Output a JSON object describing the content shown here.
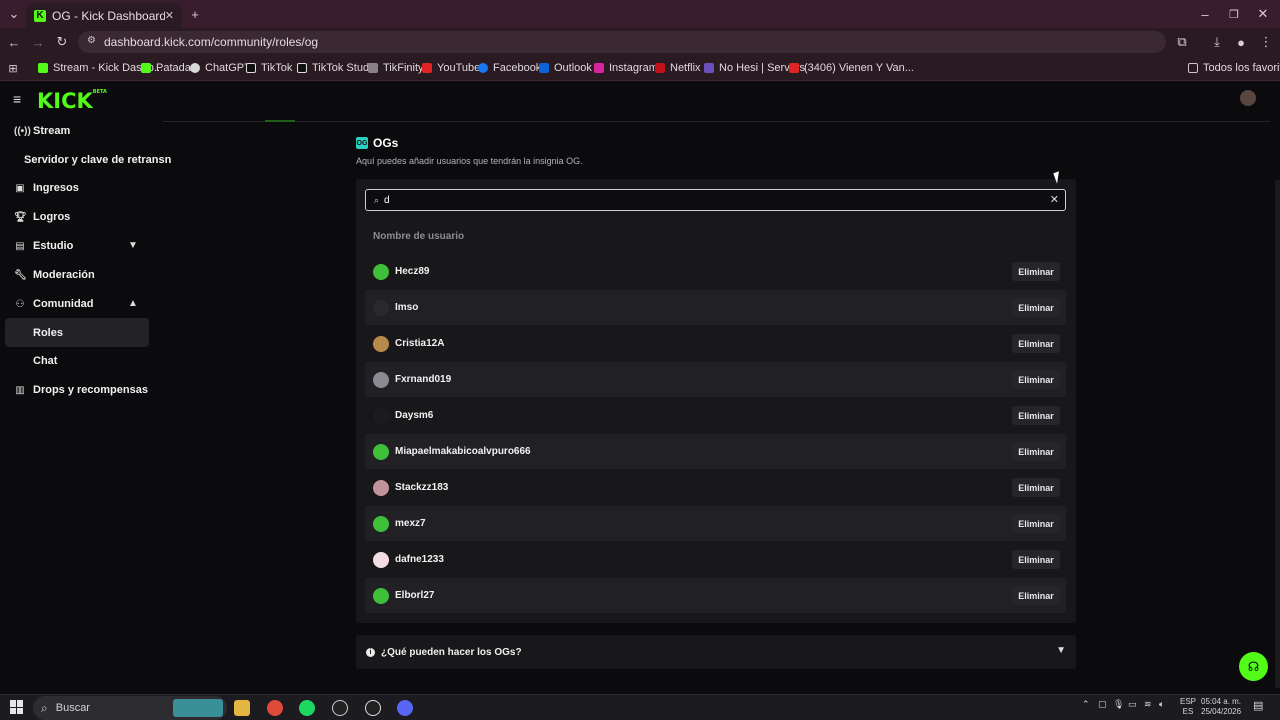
{
  "browser": {
    "tab_title": "OG - Kick Dashboard",
    "url": "dashboard.kick.com/community/roles/og",
    "bookmarks": [
      "Stream - Kick Dashb...",
      "Patada",
      "ChatGPT",
      "TikTok",
      "TikTok Studio",
      "TikFinity",
      "YouTube",
      "Facebook",
      "Outlook",
      "Instagram",
      "Netflix",
      "No Hesi | Servers",
      "(3406) Vienen Y Van..."
    ],
    "all_bookmarks": "Todos los favoritos"
  },
  "app": {
    "logo": "KICK",
    "logo_badge": "BETA"
  },
  "sidebar": {
    "items": [
      {
        "label": "Stream",
        "icon": "broadcast-icon"
      },
      {
        "label": "Servidor y clave de retransn"
      },
      {
        "label": "Ingresos",
        "icon": "wallet-icon"
      },
      {
        "label": "Logros",
        "icon": "trophy-icon"
      },
      {
        "label": "Estudio",
        "icon": "studio-icon"
      },
      {
        "label": "Moderación",
        "icon": "wrench-icon"
      },
      {
        "label": "Comunidad",
        "icon": "community-icon"
      },
      {
        "label": "Roles"
      },
      {
        "label": "Chat"
      },
      {
        "label": "Drops y recompensas",
        "icon": "gift-icon"
      }
    ]
  },
  "main": {
    "title": "OGs",
    "subtitle": "Aquí puedes añadir usuarios que tendrán la insignia OG.",
    "search_value": "d",
    "column_header": "Nombre de usuario",
    "delete_label": "Eliminar",
    "users": [
      {
        "name": "Hecz89",
        "avatar_color": "#3fbf3a"
      },
      {
        "name": "Imso",
        "avatar_color": "#2a2a2e"
      },
      {
        "name": "Cristia12A",
        "avatar_color": "#b88a4a"
      },
      {
        "name": "Fxrnand019",
        "avatar_color": "#8a8a90"
      },
      {
        "name": "Daysm6",
        "avatar_color": "#1c1c20"
      },
      {
        "name": "Miapaelmakabicoalvpuro666",
        "avatar_color": "#3fbf3a"
      },
      {
        "name": "Stackzz183",
        "avatar_color": "#c2949a"
      },
      {
        "name": "mexz7",
        "avatar_color": "#3fbf3a"
      },
      {
        "name": "dafne1233",
        "avatar_color": "#f3dce2"
      },
      {
        "name": "Elborl27",
        "avatar_color": "#3fbf3a"
      }
    ],
    "faq": "¿Qué pueden hacer los OGs?"
  },
  "taskbar": {
    "search": "Buscar",
    "lang_top": "ESP",
    "lang_bottom": "ES",
    "time": "05:04 a. m.",
    "date": "25/04/2026"
  },
  "colors": {
    "accent": "#53fc18",
    "background": "#0b0b0d",
    "card": "#18181b"
  }
}
